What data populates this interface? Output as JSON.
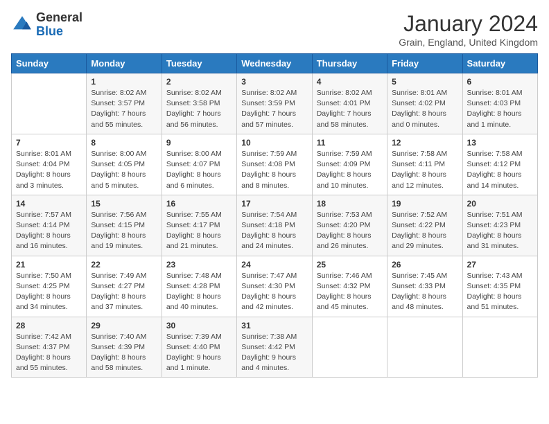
{
  "logo": {
    "general": "General",
    "blue": "Blue"
  },
  "title": "January 2024",
  "location": "Grain, England, United Kingdom",
  "days_of_week": [
    "Sunday",
    "Monday",
    "Tuesday",
    "Wednesday",
    "Thursday",
    "Friday",
    "Saturday"
  ],
  "weeks": [
    [
      {
        "day": "",
        "info": ""
      },
      {
        "day": "1",
        "info": "Sunrise: 8:02 AM\nSunset: 3:57 PM\nDaylight: 7 hours\nand 55 minutes."
      },
      {
        "day": "2",
        "info": "Sunrise: 8:02 AM\nSunset: 3:58 PM\nDaylight: 7 hours\nand 56 minutes."
      },
      {
        "day": "3",
        "info": "Sunrise: 8:02 AM\nSunset: 3:59 PM\nDaylight: 7 hours\nand 57 minutes."
      },
      {
        "day": "4",
        "info": "Sunrise: 8:02 AM\nSunset: 4:01 PM\nDaylight: 7 hours\nand 58 minutes."
      },
      {
        "day": "5",
        "info": "Sunrise: 8:01 AM\nSunset: 4:02 PM\nDaylight: 8 hours\nand 0 minutes."
      },
      {
        "day": "6",
        "info": "Sunrise: 8:01 AM\nSunset: 4:03 PM\nDaylight: 8 hours\nand 1 minute."
      }
    ],
    [
      {
        "day": "7",
        "info": "Sunrise: 8:01 AM\nSunset: 4:04 PM\nDaylight: 8 hours\nand 3 minutes."
      },
      {
        "day": "8",
        "info": "Sunrise: 8:00 AM\nSunset: 4:05 PM\nDaylight: 8 hours\nand 5 minutes."
      },
      {
        "day": "9",
        "info": "Sunrise: 8:00 AM\nSunset: 4:07 PM\nDaylight: 8 hours\nand 6 minutes."
      },
      {
        "day": "10",
        "info": "Sunrise: 7:59 AM\nSunset: 4:08 PM\nDaylight: 8 hours\nand 8 minutes."
      },
      {
        "day": "11",
        "info": "Sunrise: 7:59 AM\nSunset: 4:09 PM\nDaylight: 8 hours\nand 10 minutes."
      },
      {
        "day": "12",
        "info": "Sunrise: 7:58 AM\nSunset: 4:11 PM\nDaylight: 8 hours\nand 12 minutes."
      },
      {
        "day": "13",
        "info": "Sunrise: 7:58 AM\nSunset: 4:12 PM\nDaylight: 8 hours\nand 14 minutes."
      }
    ],
    [
      {
        "day": "14",
        "info": "Sunrise: 7:57 AM\nSunset: 4:14 PM\nDaylight: 8 hours\nand 16 minutes."
      },
      {
        "day": "15",
        "info": "Sunrise: 7:56 AM\nSunset: 4:15 PM\nDaylight: 8 hours\nand 19 minutes."
      },
      {
        "day": "16",
        "info": "Sunrise: 7:55 AM\nSunset: 4:17 PM\nDaylight: 8 hours\nand 21 minutes."
      },
      {
        "day": "17",
        "info": "Sunrise: 7:54 AM\nSunset: 4:18 PM\nDaylight: 8 hours\nand 24 minutes."
      },
      {
        "day": "18",
        "info": "Sunrise: 7:53 AM\nSunset: 4:20 PM\nDaylight: 8 hours\nand 26 minutes."
      },
      {
        "day": "19",
        "info": "Sunrise: 7:52 AM\nSunset: 4:22 PM\nDaylight: 8 hours\nand 29 minutes."
      },
      {
        "day": "20",
        "info": "Sunrise: 7:51 AM\nSunset: 4:23 PM\nDaylight: 8 hours\nand 31 minutes."
      }
    ],
    [
      {
        "day": "21",
        "info": "Sunrise: 7:50 AM\nSunset: 4:25 PM\nDaylight: 8 hours\nand 34 minutes."
      },
      {
        "day": "22",
        "info": "Sunrise: 7:49 AM\nSunset: 4:27 PM\nDaylight: 8 hours\nand 37 minutes."
      },
      {
        "day": "23",
        "info": "Sunrise: 7:48 AM\nSunset: 4:28 PM\nDaylight: 8 hours\nand 40 minutes."
      },
      {
        "day": "24",
        "info": "Sunrise: 7:47 AM\nSunset: 4:30 PM\nDaylight: 8 hours\nand 42 minutes."
      },
      {
        "day": "25",
        "info": "Sunrise: 7:46 AM\nSunset: 4:32 PM\nDaylight: 8 hours\nand 45 minutes."
      },
      {
        "day": "26",
        "info": "Sunrise: 7:45 AM\nSunset: 4:33 PM\nDaylight: 8 hours\nand 48 minutes."
      },
      {
        "day": "27",
        "info": "Sunrise: 7:43 AM\nSunset: 4:35 PM\nDaylight: 8 hours\nand 51 minutes."
      }
    ],
    [
      {
        "day": "28",
        "info": "Sunrise: 7:42 AM\nSunset: 4:37 PM\nDaylight: 8 hours\nand 55 minutes."
      },
      {
        "day": "29",
        "info": "Sunrise: 7:40 AM\nSunset: 4:39 PM\nDaylight: 8 hours\nand 58 minutes."
      },
      {
        "day": "30",
        "info": "Sunrise: 7:39 AM\nSunset: 4:40 PM\nDaylight: 9 hours\nand 1 minute."
      },
      {
        "day": "31",
        "info": "Sunrise: 7:38 AM\nSunset: 4:42 PM\nDaylight: 9 hours\nand 4 minutes."
      },
      {
        "day": "",
        "info": ""
      },
      {
        "day": "",
        "info": ""
      },
      {
        "day": "",
        "info": ""
      }
    ]
  ]
}
